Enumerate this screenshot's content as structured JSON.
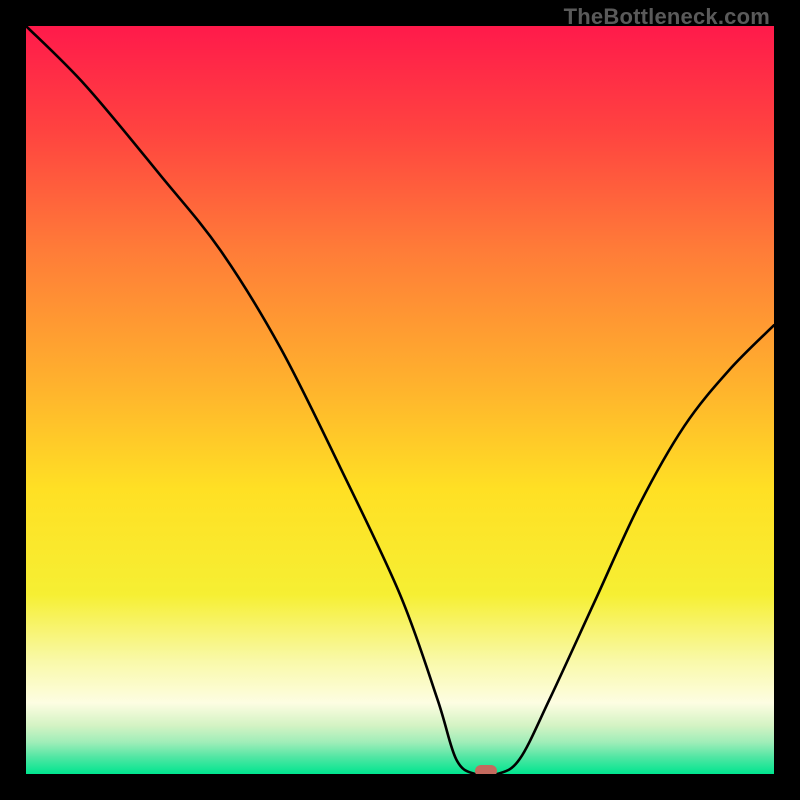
{
  "watermark": "TheBottleneck.com",
  "chart_data": {
    "type": "line",
    "title": "",
    "xlabel": "",
    "ylabel": "",
    "xlim": [
      0,
      100
    ],
    "ylim": [
      0,
      100
    ],
    "grid": false,
    "legend": false,
    "background_gradient": [
      {
        "stop": 0.0,
        "color": "#ff1a4b"
      },
      {
        "stop": 0.14,
        "color": "#ff4340"
      },
      {
        "stop": 0.3,
        "color": "#ff7c38"
      },
      {
        "stop": 0.48,
        "color": "#ffb22d"
      },
      {
        "stop": 0.62,
        "color": "#ffe024"
      },
      {
        "stop": 0.76,
        "color": "#f6ef33"
      },
      {
        "stop": 0.85,
        "color": "#f9f9aa"
      },
      {
        "stop": 0.905,
        "color": "#fdfde2"
      },
      {
        "stop": 0.935,
        "color": "#d4f3c4"
      },
      {
        "stop": 0.958,
        "color": "#9eedb8"
      },
      {
        "stop": 0.978,
        "color": "#4fe6a3"
      },
      {
        "stop": 1.0,
        "color": "#00e58f"
      }
    ],
    "series": [
      {
        "name": "bottleneck-curve",
        "color": "#000000",
        "x": [
          0,
          8,
          18,
          26,
          34,
          42,
          50,
          55,
          57.5,
          60,
          63,
          66,
          70,
          76,
          82,
          88,
          94,
          100
        ],
        "y": [
          100,
          92,
          80,
          70,
          57,
          41,
          24,
          10,
          2,
          0,
          0,
          2,
          10,
          23,
          36,
          46.5,
          54,
          60
        ]
      }
    ],
    "marker": {
      "x": 61.5,
      "y": 0,
      "color": "#c46a5e",
      "label": "optimal-point"
    }
  }
}
